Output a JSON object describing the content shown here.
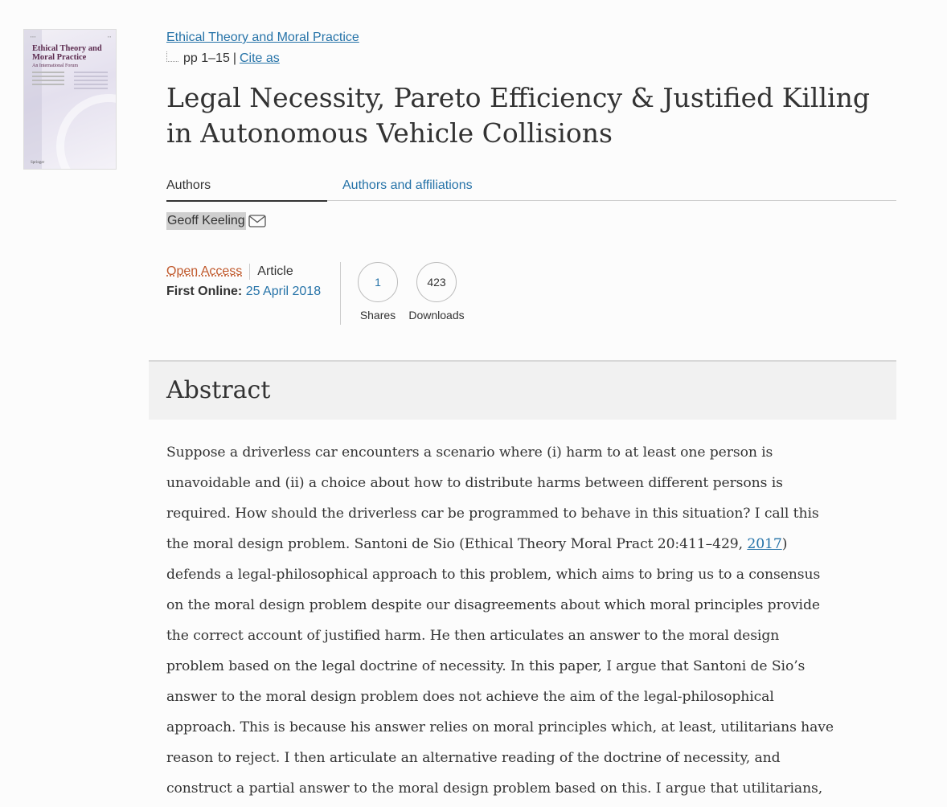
{
  "cover": {
    "journal_title": "Ethical Theory and Moral Practice",
    "subtitle": "An International Forum",
    "publisher": "Springer"
  },
  "header": {
    "journal_link": "Ethical Theory and Moral Practice",
    "pages": "pp 1–15",
    "separator": "|",
    "cite_as": "Cite as"
  },
  "article": {
    "title": "Legal Necessity, Pareto Efficiency & Justified Killing in Autonomous Vehicle Collisions"
  },
  "tabs": {
    "authors": "Authors",
    "authors_and_affiliations": "Authors and affiliations"
  },
  "author": {
    "name": "Geoff Keeling",
    "icon": "mail-icon"
  },
  "meta": {
    "access": "Open Access",
    "type": "Article",
    "first_online_label": "First Online:",
    "first_online_date": "25 April 2018"
  },
  "metrics": {
    "shares_value": "1",
    "shares_label": "Shares",
    "downloads_value": "423",
    "downloads_label": "Downloads"
  },
  "abstract": {
    "heading": "Abstract",
    "lines": [
      "Suppose a driverless car encounters a scenario where (i) harm to at least one person is",
      "unavoidable and (ii) a choice about how to distribute harms between different persons is",
      "required. How should the driverless car be programmed to behave in this situation? I call this",
      "the moral design problem. Santoni de Sio (Ethical Theory Moral Pract 20:411–429, ",
      "defends a legal-philosophical approach to this problem, which aims to bring us to a consensus",
      "on the moral design problem despite our disagreements about which moral principles provide",
      "the correct account of justified harm. He then articulates an answer to the moral design",
      "problem based on the legal doctrine of necessity. In this paper, I argue that Santoni de Sio’s",
      "answer to the moral design problem does not achieve the aim of the legal-philosophical",
      "approach. This is because his answer relies on moral principles which, at least, utilitarians have",
      "reason to reject. I then articulate an alternative reading of the doctrine of necessity, and",
      "construct a partial answer to the moral design problem based on this. I argue that utilitarians,"
    ],
    "ref_year": "2017",
    "ref_close": ")"
  }
}
